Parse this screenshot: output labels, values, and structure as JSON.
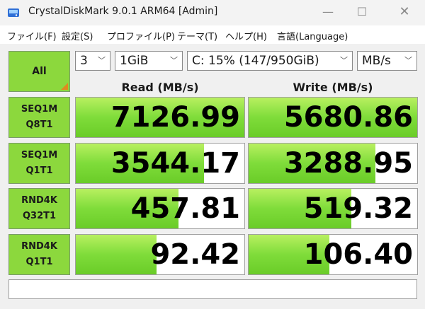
{
  "window": {
    "title": "CrystalDiskMark 9.0.1 ARM64 [Admin]"
  },
  "menu": [
    {
      "label": "ファイル(F)"
    },
    {
      "label": "設定(S)"
    },
    {
      "label": "プロファイル(P)"
    },
    {
      "label": "テーマ(T)"
    },
    {
      "label": "ヘルプ(H)"
    },
    {
      "label": "言語(Language)"
    }
  ],
  "controls": {
    "all_label": "All",
    "count": "3",
    "size": "1GiB",
    "drive": "C: 15% (147/950GiB)",
    "unit": "MB/s"
  },
  "headers": {
    "read": "Read (MB/s)",
    "write": "Write (MB/s)"
  },
  "tests": [
    {
      "line1": "SEQ1M",
      "line2": "Q8T1",
      "read": "7126.99",
      "write": "5680.86",
      "read_fill": 1.0,
      "write_fill": 1.0
    },
    {
      "line1": "SEQ1M",
      "line2": "Q1T1",
      "read": "3544.17",
      "write": "3288.95",
      "read_fill": 0.76,
      "write_fill": 0.75
    },
    {
      "line1": "RND4K",
      "line2": "Q32T1",
      "read": "457.81",
      "write": "519.32",
      "read_fill": 0.61,
      "write_fill": 0.61
    },
    {
      "line1": "RND4K",
      "line2": "Q1T1",
      "read": "92.42",
      "write": "106.40",
      "read_fill": 0.48,
      "write_fill": 0.48
    }
  ],
  "status": "",
  "colors": {
    "bar": "#7fdc3a",
    "button": "#8cd83d",
    "accent_corner": "#e08a20"
  },
  "icons": {
    "app": "app-disk-icon",
    "minimize": "minimize-icon",
    "maximize": "maximize-icon",
    "close": "close-icon",
    "dropdown": "chevron-down-icon"
  }
}
